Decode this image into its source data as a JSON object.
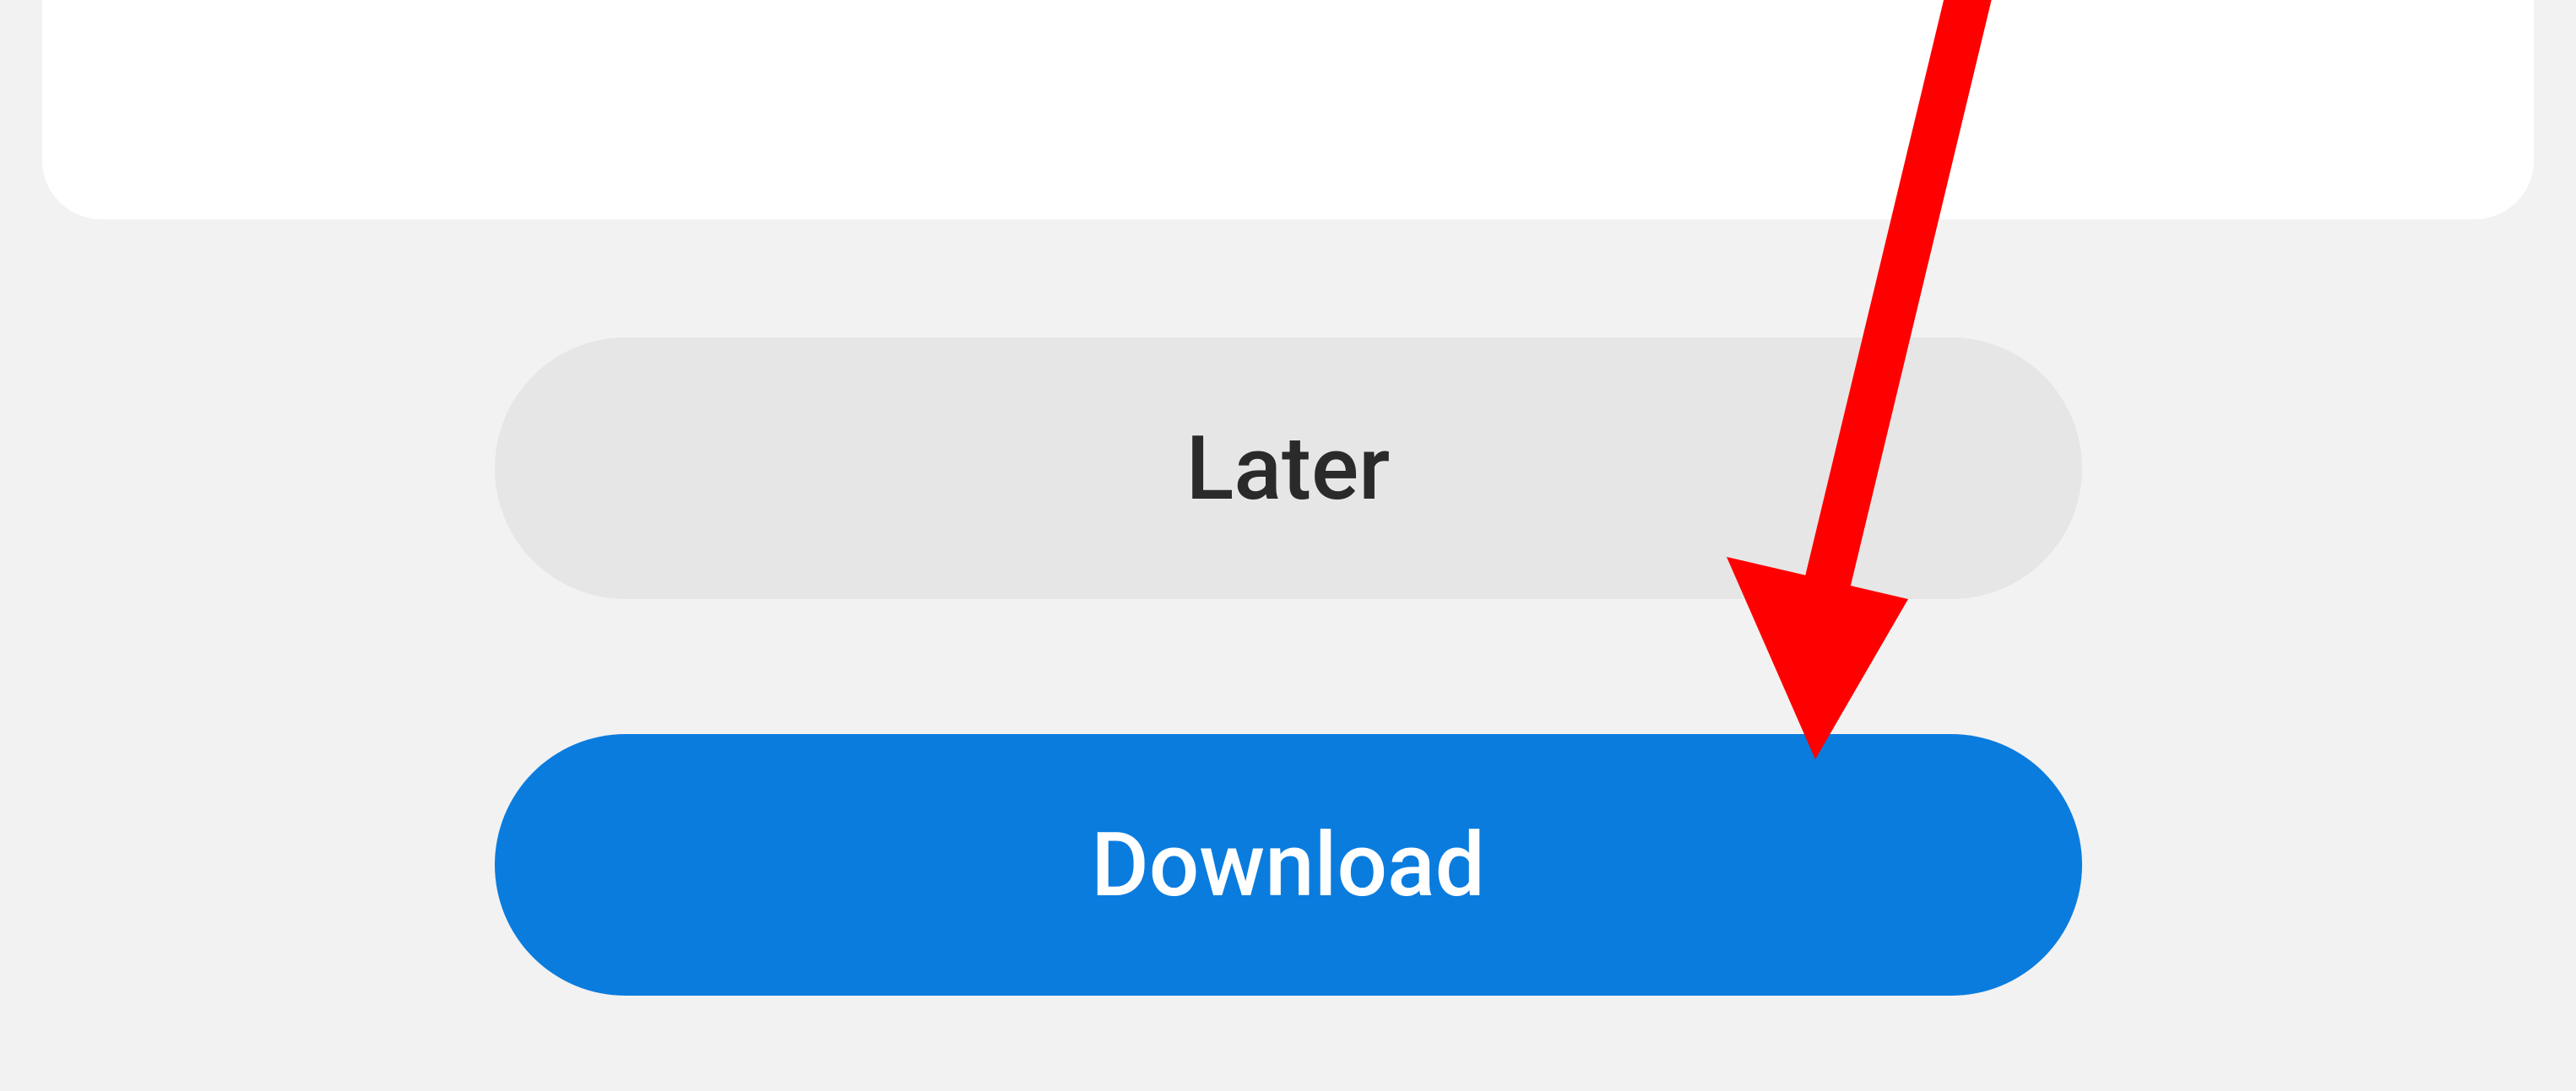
{
  "buttons": {
    "later_label": "Later",
    "download_label": "Download"
  },
  "colors": {
    "later_bg": "#e6e6e6",
    "later_text": "#2a2a2a",
    "download_bg": "#0a7cde",
    "download_text": "#ffffff",
    "arrow": "#ff0000"
  }
}
